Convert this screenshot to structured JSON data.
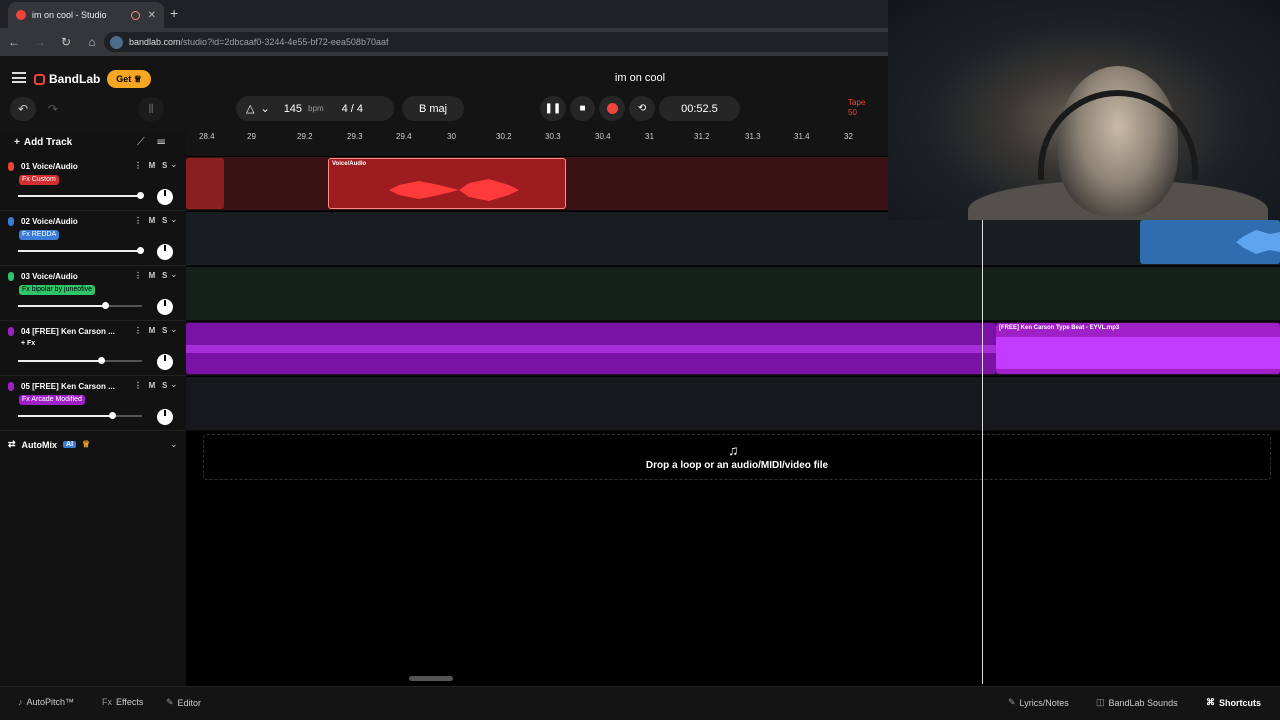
{
  "browser": {
    "tab_title": "im on cool - Studio",
    "new_tab": "+",
    "url_host": "bandlab.com",
    "url_path": "/studio?id=2dbcaaf0-3244-4e55-bf72-eea508b70aaf"
  },
  "header": {
    "logo": "BandLab",
    "get_label": "Get",
    "project_title": "im on cool",
    "tempo": "145",
    "tempo_unit": "bpm",
    "time_signature": "4 / 4",
    "key": "B maj",
    "time": "00:52.5",
    "tapes_label": "Tape",
    "tapes_count": "50"
  },
  "sidebar": {
    "add_track": "Add Track",
    "automix": "AutoMix",
    "ai_badge": "AI",
    "tracks": [
      {
        "name": "01 Voice/Audio",
        "fx": "Fx Custom",
        "color": "#f0443a",
        "volume": 0.98
      },
      {
        "name": "02 Voice/Audio",
        "fx": "Fx REDDA",
        "color": "#3a7bd5",
        "volume": 0.98
      },
      {
        "name": "03 Voice/Audio",
        "fx": "Fx bipolar by juneofive",
        "color": "#2fc46a",
        "volume": 0.7
      },
      {
        "name": "04 [FREE] Ken Carson ...",
        "fx": "+ Fx",
        "color": "#a020c8",
        "volume": 0.67
      },
      {
        "name": "05 [FREE] Ken Carson ...",
        "fx": "Fx Arcade Modified",
        "color": "#a020c8",
        "volume": 0.76
      }
    ],
    "mute": "M",
    "solo": "S"
  },
  "ruler": {
    "labels": [
      "28.4",
      "29",
      "29.2",
      "29.3",
      "29.4",
      "30",
      "30.2",
      "30.3",
      "30.4",
      "31",
      "31.2",
      "31.3",
      "31.4",
      "32"
    ]
  },
  "clips": {
    "voice_clip_label": "Voice/Audio",
    "beat_clip_label": "[FREE] Ken Carson Type Beat - EYVL.mp3"
  },
  "drop_zone": {
    "text": "Drop a loop or an audio/MIDI/video file"
  },
  "bottom": {
    "autopitch": "AutoPitch™",
    "effects": "Effects",
    "editor": "Editor",
    "lyrics": "Lyrics/Notes",
    "sounds": "BandLab Sounds",
    "shortcuts": "Shortcuts"
  },
  "colors": {
    "accent": "#f0443a",
    "get": "#f5a623",
    "purple": "#a020c8",
    "blue": "#3a7bd5",
    "green": "#2fc46a"
  }
}
